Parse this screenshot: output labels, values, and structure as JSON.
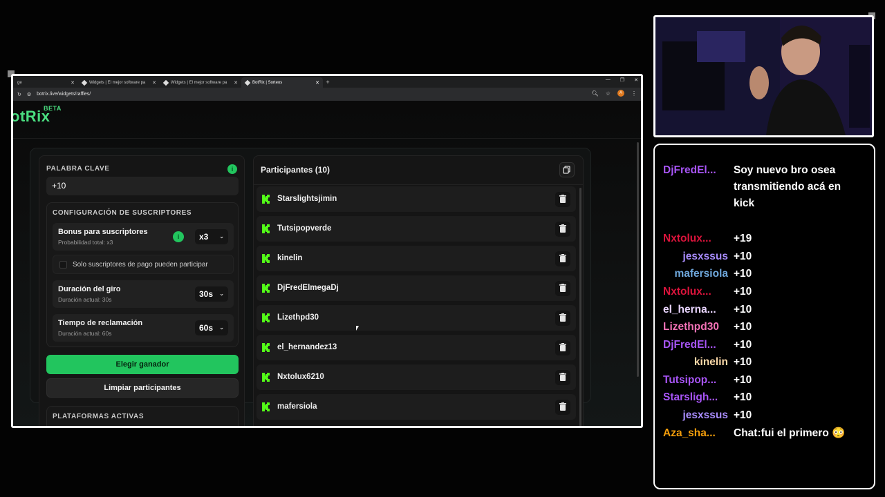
{
  "browser": {
    "tabs": [
      {
        "title": "ge"
      },
      {
        "title": "Widgets | El mejor software pa"
      },
      {
        "title": "Widgets | El mejor software pa"
      },
      {
        "title": "BotRix | Sorteos"
      }
    ],
    "url": "botrix.live/widgets/raffles/",
    "profile_initial": "A"
  },
  "app": {
    "logo": "otRix",
    "beta": "BETA"
  },
  "left": {
    "keyword_label": "PALABRA CLAVE",
    "keyword_value": "+10",
    "subs_config_label": "CONFIGURACIÓN DE SUSCRIPTORES",
    "bonus_title": "Bonus para suscriptores",
    "bonus_sub": "Probabilidad total: x3",
    "bonus_value": "x3",
    "paid_only_label": "Solo suscriptores de pago pueden participar",
    "spin_title": "Duración del giro",
    "spin_sub": "Duración actual: 30s",
    "spin_value": "30s",
    "claim_title": "Tiempo de reclamación",
    "claim_sub": "Duración actual: 60s",
    "claim_value": "60s",
    "pick_winner": "Elegir ganador",
    "clear_participants": "Limpiar participantes",
    "platforms_label": "PLATAFORMAS ACTIVAS"
  },
  "right": {
    "title": "Participantes (10)",
    "participants": [
      "Starslightsjimin",
      "Tutsipopverde",
      "kinelin",
      "DjFredElmegaDj",
      "Lizethpd30",
      "el_hernandez13",
      "Nxtolux6210",
      "mafersiola"
    ]
  },
  "chat": {
    "messages": [
      {
        "user": "DjFredEl...",
        "color": "#a855f7",
        "text": "Soy nuevo bro osea transmitiendo acá en kick"
      },
      {
        "user": "Nxtolux...",
        "color": "#dc143c",
        "text": "+19"
      },
      {
        "user": "jesxssus",
        "color": "#a78bfa",
        "text": "+10"
      },
      {
        "user": "mafersiola",
        "color": "#6fa8dc",
        "text": "+10"
      },
      {
        "user": "Nxtolux...",
        "color": "#dc143c",
        "text": "+10"
      },
      {
        "user": "el_herna...",
        "color": "#e9d5ff",
        "text": "+10"
      },
      {
        "user": "Lizethpd30",
        "color": "#f472b6",
        "text": "+10"
      },
      {
        "user": "DjFredEl...",
        "color": "#a855f7",
        "text": "+10"
      },
      {
        "user": "kinelin",
        "color": "#fcd9a8",
        "text": "+10"
      },
      {
        "user": "Tutsipop...",
        "color": "#a855f7",
        "text": "+10"
      },
      {
        "user": "Starsligh...",
        "color": "#a855f7",
        "text": "+10"
      },
      {
        "user": "jesxssus",
        "color": "#a78bfa",
        "text": "+10"
      },
      {
        "user": "Aza_sha...",
        "color": "#f59e0b",
        "text": "Chat:fui el primero 😳"
      }
    ]
  },
  "colors": {
    "accent": "#22c55e",
    "kick": "#53fc18"
  }
}
